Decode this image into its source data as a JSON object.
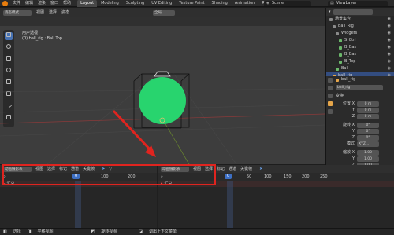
{
  "topbar": {
    "menus": [
      "文件",
      "编辑",
      "渲染",
      "窗口",
      "帮助"
    ],
    "workspaces": [
      "Layout",
      "Modeling",
      "Sculpting",
      "UV Editing",
      "Texture Paint",
      "Shading",
      "Animation",
      "Rendering"
    ],
    "active_workspace": "Layout",
    "scene": "Scene",
    "view_layer": "ViewLayer"
  },
  "viewport": {
    "mode": "姿态模式",
    "menus": [
      "视图",
      "选择",
      "姿态"
    ],
    "orientation": "全局",
    "view_name": "用户透视",
    "view_sub": "(0) ball_rig : Ball.Top",
    "ball_color": "#28d46e"
  },
  "outliner": {
    "header": "场景集合",
    "rows": [
      {
        "label": "场景集合",
        "kind": "grey"
      },
      {
        "label": "Ball_Rig",
        "kind": "grey"
      },
      {
        "label": "Widgets",
        "kind": "grey"
      },
      {
        "label": "S_Ctrl",
        "kind": "green"
      },
      {
        "label": "B_Bas",
        "kind": "green"
      },
      {
        "label": "B_Bas",
        "kind": "green"
      },
      {
        "label": "B_Top",
        "kind": "green"
      },
      {
        "label": "Ball",
        "kind": "green"
      },
      {
        "label": "ball_rig",
        "kind": "orange"
      }
    ],
    "selected_index": 8
  },
  "properties": {
    "object": "ball_rig",
    "object_name": "ball_rig",
    "section": "变换",
    "loc_label": "位置 X",
    "loc": [
      "0 m",
      "0 m",
      "0 m"
    ],
    "rot_label": "旋转 X",
    "rot": [
      "0°",
      "0°",
      "0°"
    ],
    "mode_label": "模式",
    "mode_value": "XYZ...",
    "scale_label": "缩放 X",
    "scale": [
      "1.00",
      "1.00",
      "1.00"
    ],
    "axis_y": "Y",
    "axis_z": "Z"
  },
  "timeline_left": {
    "mode": "动画摄影表",
    "menus": [
      "视图",
      "选择",
      "标记",
      "通道",
      "关键帧"
    ],
    "current_frame": "0",
    "ticks": [
      "100",
      "200"
    ],
    "summary": "汇总"
  },
  "timeline_right": {
    "mode": "动画摄影表",
    "menus": [
      "视图",
      "选择",
      "标记",
      "通道",
      "关键帧"
    ],
    "current_frame": "0",
    "ticks": [
      "50",
      "100",
      "150",
      "200",
      "250"
    ],
    "summary": "汇总"
  },
  "status": {
    "left_a": "选择",
    "left_b": "平移视图",
    "right_a": "旋转视图",
    "right_b": "调出上下文菜单"
  }
}
